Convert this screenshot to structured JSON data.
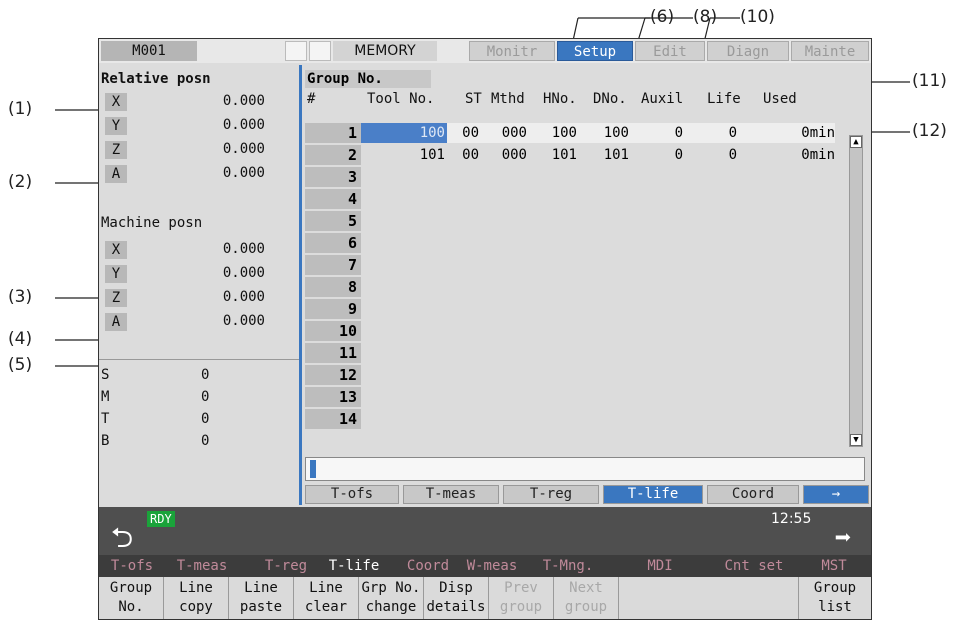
{
  "annotations": [
    "(1)",
    "(2)",
    "(3)",
    "(4)",
    "(5)",
    "(6)",
    "(8)",
    "(10)",
    "(11)",
    "(12)"
  ],
  "topbar": {
    "program": "M001",
    "mode": "MEMORY",
    "tabs": [
      {
        "label": "Monitr",
        "active": false
      },
      {
        "label": "Setup",
        "active": true
      },
      {
        "label": "Edit",
        "active": false
      },
      {
        "label": "Diagn",
        "active": false
      },
      {
        "label": "Mainte",
        "active": false
      }
    ]
  },
  "relative": {
    "title": "Relative posn",
    "axes": [
      {
        "name": "X",
        "value": "0.000"
      },
      {
        "name": "Y",
        "value": "0.000"
      },
      {
        "name": "Z",
        "value": "0.000"
      },
      {
        "name": "A",
        "value": "0.000"
      }
    ]
  },
  "machine": {
    "title": "Machine posn",
    "axes": [
      {
        "name": "X",
        "value": "0.000"
      },
      {
        "name": "Y",
        "value": "0.000"
      },
      {
        "name": "Z",
        "value": "0.000"
      },
      {
        "name": "A",
        "value": "0.000"
      }
    ]
  },
  "modal": [
    {
      "name": "S",
      "value": "0"
    },
    {
      "name": "M",
      "value": "0"
    },
    {
      "name": "T",
      "value": "0"
    },
    {
      "name": "B",
      "value": "0"
    }
  ],
  "table": {
    "group_label": "Group No.",
    "headers": {
      "num": "#",
      "tool": "Tool No.",
      "st": "ST",
      "mthd": "Mthd",
      "hno": "HNo.",
      "dno": "DNo.",
      "auxil": "Auxil",
      "life": "Life",
      "used": "Used"
    },
    "row_numbers": [
      "1",
      "2",
      "3",
      "4",
      "5",
      "6",
      "7",
      "8",
      "9",
      "10",
      "11",
      "12",
      "13",
      "14"
    ],
    "rows": [
      {
        "tool": "100",
        "st": "00",
        "mthd": "000",
        "hno": "100",
        "dno": "100",
        "auxil": "0",
        "life": "0",
        "used": "0min"
      },
      {
        "tool": "101",
        "st": "00",
        "mthd": "000",
        "hno": "101",
        "dno": "101",
        "auxil": "0",
        "life": "0",
        "used": "0min"
      }
    ]
  },
  "page_tabs": [
    {
      "label": "T-ofs",
      "active": false
    },
    {
      "label": "T-meas",
      "active": false
    },
    {
      "label": "T-reg",
      "active": false
    },
    {
      "label": "T-life",
      "active": true
    },
    {
      "label": "Coord",
      "active": false
    },
    {
      "label": "→",
      "active": false
    }
  ],
  "status": {
    "rdy": "RDY",
    "time": "12:55"
  },
  "menu": [
    {
      "label": "T-ofs",
      "active": false
    },
    {
      "label": "T-meas",
      "active": false
    },
    {
      "label": "T-reg",
      "active": false
    },
    {
      "label": "T-life",
      "active": true
    },
    {
      "label": "Coord",
      "active": false
    },
    {
      "label": "W-meas",
      "active": false
    },
    {
      "label": "T-Mng.",
      "active": false
    },
    {
      "label": "MDI",
      "active": false
    },
    {
      "label": "Cnt set",
      "active": false
    },
    {
      "label": "MST",
      "active": false
    }
  ],
  "fkeys": [
    {
      "l1": "Group",
      "l2": "No.",
      "enabled": true
    },
    {
      "l1": "Line",
      "l2": "copy",
      "enabled": true
    },
    {
      "l1": "Line",
      "l2": "paste",
      "enabled": true
    },
    {
      "l1": "Line",
      "l2": "clear",
      "enabled": true
    },
    {
      "l1": "Grp No.",
      "l2": "change",
      "enabled": true
    },
    {
      "l1": "Disp",
      "l2": "details",
      "enabled": true
    },
    {
      "l1": "Prev",
      "l2": "group",
      "enabled": false
    },
    {
      "l1": "Next",
      "l2": "group",
      "enabled": false
    },
    {
      "l1": "",
      "l2": "",
      "enabled": false
    },
    {
      "l1": "Group",
      "l2": "list",
      "enabled": true
    }
  ]
}
